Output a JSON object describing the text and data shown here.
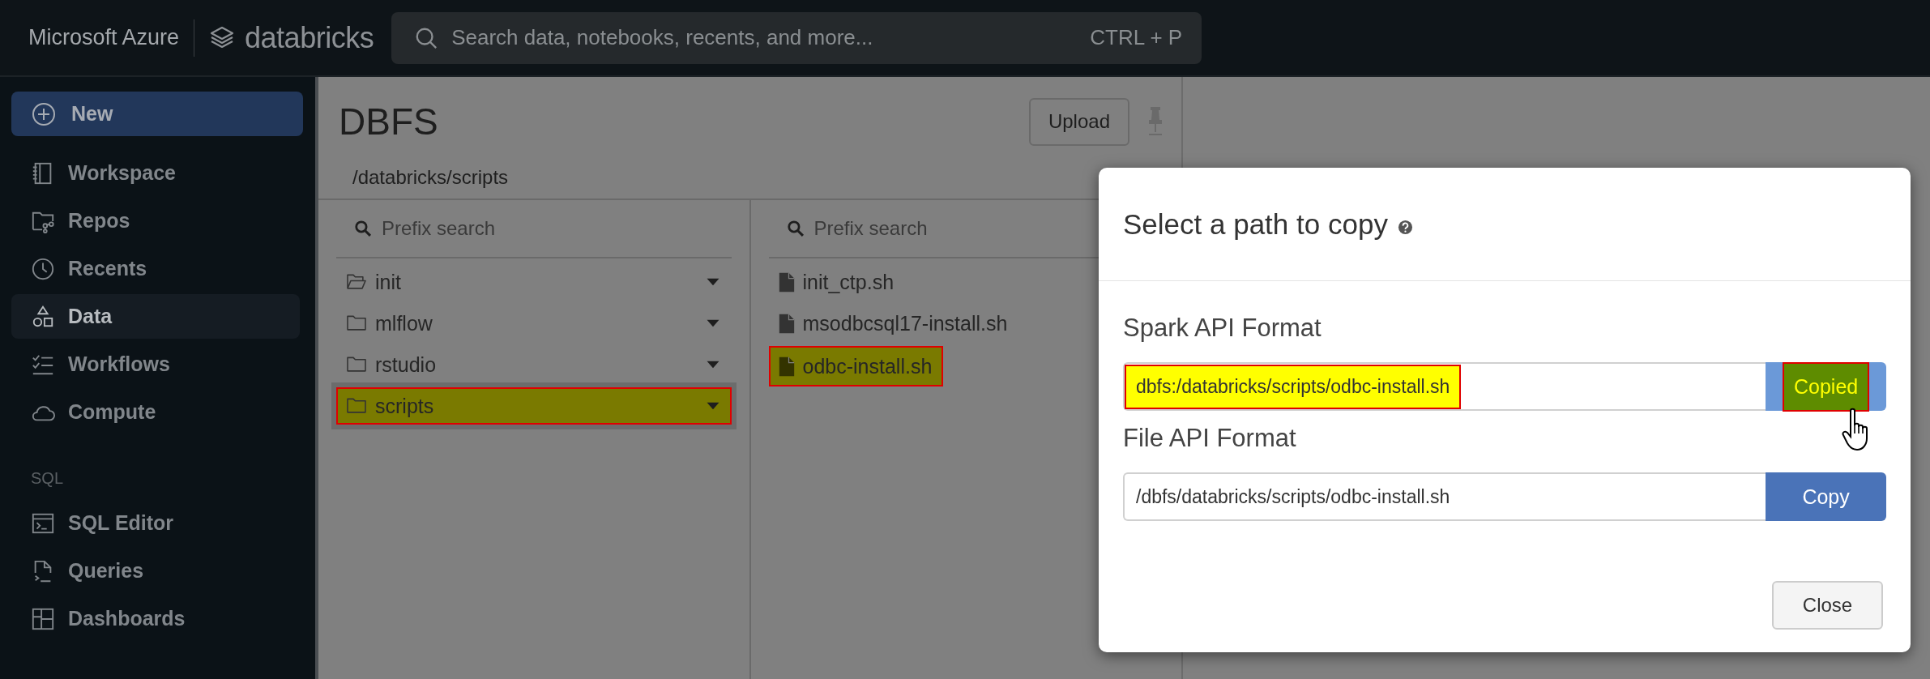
{
  "topbar": {
    "brand": "Microsoft Azure",
    "product": "databricks",
    "search": {
      "placeholder": "Search data, notebooks, recents, and more...",
      "shortcut": "CTRL + P"
    }
  },
  "sidebar": {
    "new_button": "New",
    "sections": [
      {
        "items": [
          {
            "label": "Workspace",
            "kind": "workspace",
            "selected": false
          },
          {
            "label": "Repos",
            "kind": "repos",
            "selected": false
          },
          {
            "label": "Recents",
            "kind": "recents",
            "selected": false
          },
          {
            "label": "Data",
            "kind": "data",
            "selected": true
          },
          {
            "label": "Workflows",
            "kind": "workflows",
            "selected": false
          },
          {
            "label": "Compute",
            "kind": "compute",
            "selected": false
          }
        ]
      },
      {
        "heading": "SQL",
        "items": [
          {
            "label": "SQL Editor",
            "kind": "editor",
            "selected": false
          },
          {
            "label": "Queries",
            "kind": "queries",
            "selected": false
          },
          {
            "label": "Dashboards",
            "kind": "dashboards",
            "selected": false
          }
        ]
      }
    ]
  },
  "dbfs": {
    "title": "DBFS",
    "upload": "Upload",
    "path": "/databricks/scripts",
    "columns": [
      {
        "search_placeholder": "Prefix search",
        "items": [
          {
            "name": "init",
            "kind": "folder",
            "open": true,
            "selected": false,
            "highlighted": false
          },
          {
            "name": "mlflow",
            "kind": "folder",
            "open": false,
            "selected": false,
            "highlighted": false
          },
          {
            "name": "rstudio",
            "kind": "folder",
            "open": false,
            "selected": false,
            "highlighted": false
          },
          {
            "name": "scripts",
            "kind": "folder",
            "open": false,
            "selected": true,
            "highlighted": true
          }
        ]
      },
      {
        "search_placeholder": "Prefix search",
        "items": [
          {
            "name": "init_ctp.sh",
            "kind": "file",
            "highlighted": false
          },
          {
            "name": "msodbcsql17-install.sh",
            "kind": "file",
            "highlighted": false
          },
          {
            "name": "odbc-install.sh",
            "kind": "file",
            "highlighted": true
          }
        ]
      }
    ]
  },
  "modal": {
    "title": "Select a path to copy",
    "fields": [
      {
        "label": "Spark API Format",
        "value": "dbfs:/databricks/scripts/odbc-install.sh",
        "button": "Copied",
        "copied": true,
        "highlighted": true
      },
      {
        "label": "File API Format",
        "value": "/dbfs/databricks/scripts/odbc-install.sh",
        "button": "Copy",
        "copied": false,
        "highlighted": false
      }
    ],
    "close": "Close"
  }
}
